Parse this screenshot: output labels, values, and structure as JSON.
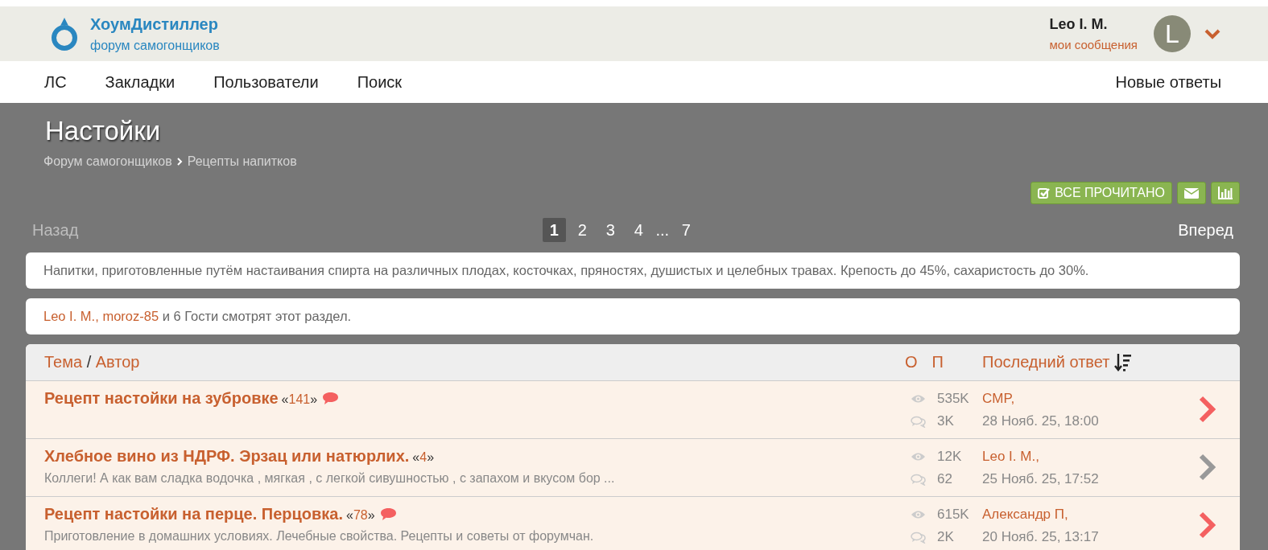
{
  "site": {
    "title": "ХоумДистиллер",
    "subtitle": "форум самогонщиков"
  },
  "user": {
    "name": "Leo I. M.",
    "link": "мои сообщения",
    "avatar_letter": "L"
  },
  "nav": {
    "left": [
      "ЛС",
      "Закладки",
      "Пользователи",
      "Поиск"
    ],
    "right": [
      "Новые ответы"
    ]
  },
  "page": {
    "title": "Настойки",
    "breadcrumbs": [
      "Форум самогонщиков",
      "Рецепты напитков"
    ]
  },
  "toolbar": [
    {
      "kind": "mark-read",
      "label": "ВСЕ ПРОЧИТАНО"
    },
    {
      "kind": "mail"
    },
    {
      "kind": "stats"
    }
  ],
  "pagination": {
    "prev": {
      "label": "Назад",
      "disabled": true
    },
    "next": {
      "label": "Вперед",
      "disabled": false
    },
    "pages": [
      {
        "kind": "page",
        "label": "1",
        "selected": true
      },
      {
        "kind": "page",
        "label": "2",
        "selected": false
      },
      {
        "kind": "page",
        "label": "3",
        "selected": false
      },
      {
        "kind": "page",
        "label": "4",
        "selected": false
      },
      {
        "kind": "gap",
        "label": "..."
      },
      {
        "kind": "page",
        "label": "7",
        "selected": false
      }
    ]
  },
  "description": "Напитки, приготовленные путём настаивания спирта на различных плодах, косточках, пряностях, душистых и целебных травах. Крепость до 45%, сахаристость до 30%.",
  "viewers": [
    {
      "kind": "user",
      "text": "Leo I. M.,"
    },
    {
      "kind": "user",
      "text": "moroz-85"
    },
    {
      "kind": "text",
      "text": " и 6 Гости смотрят этот раздел."
    }
  ],
  "table": {
    "header": {
      "topic": "Тема",
      "separator": " / ",
      "author": "Автор",
      "views": "О",
      "posts": "П",
      "last_reply": "Последний ответ"
    },
    "rows": [
      {
        "title": "Рецепт настойки на зубровке",
        "pages": {
          "open": "«",
          "count": "141",
          "close": "»"
        },
        "views": "535K",
        "replies": "3K",
        "last_user": "CMP,",
        "last_date": "28 Нояб. 25, 18:00",
        "unread": true
      },
      {
        "title": "Хлебное вино из НДРФ. Эрзац или натюрлих.",
        "pages": {
          "open": "«",
          "count": "4",
          "close": "»"
        },
        "snippet": "Коллеги! А как вам сладка водочка , мягкая , с легкой сивушностью , с запахом и вкусом бор ...",
        "views": "12K",
        "replies": "62",
        "last_user": "Leo I. M.,",
        "last_date": "25 Нояб. 25, 17:52",
        "unread": false
      },
      {
        "title": "Рецепт настойки на перце. Перцовка.",
        "pages": {
          "open": "«",
          "count": "78",
          "close": "»"
        },
        "snippet": "Приготовление в домашних условиях. Лечебные свойства. Рецепты и советы от форумчан.",
        "views": "615K",
        "replies": "2K",
        "last_user": "Александр П,",
        "last_date": "20 Нояб. 25, 13:17",
        "unread": true
      }
    ]
  }
}
